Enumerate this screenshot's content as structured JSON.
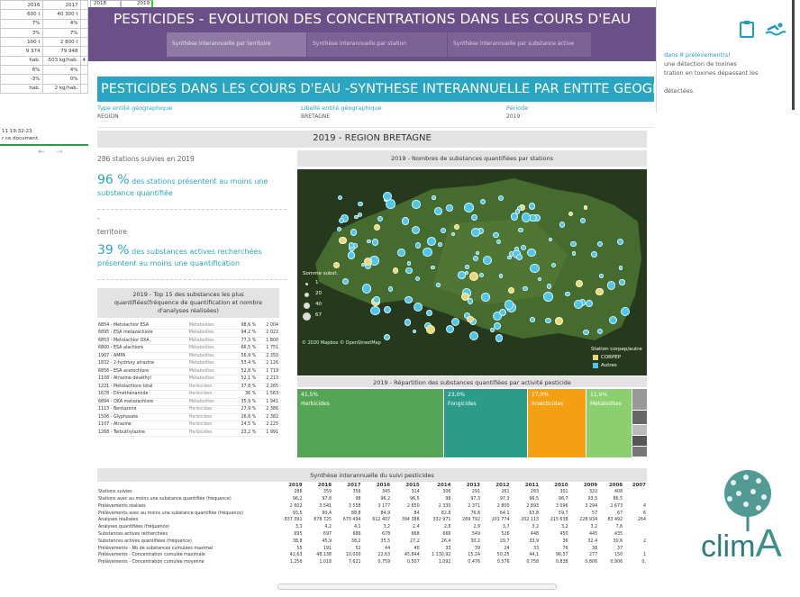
{
  "background_left": {
    "rows": [
      [
        "2016",
        "2017",
        ""
      ],
      [
        "600 t",
        "40 300 t",
        ""
      ],
      [
        "7%",
        "4%",
        ""
      ],
      [
        "3%",
        "7%",
        ""
      ],
      [
        "100 t",
        "2 800 t",
        ""
      ],
      [
        "9 374",
        "79 948",
        ""
      ],
      [
        "hab.",
        "503 kg/hab.",
        "4"
      ],
      [
        "6%",
        "4%",
        ""
      ],
      [
        "-3%",
        "0%",
        ""
      ],
      [
        "hab.",
        "2 kg/hab.",
        ""
      ]
    ],
    "top_cells": [
      "2018",
      "2019"
    ],
    "time": "11 19:32:23",
    "note": "r ce document.",
    "nav_back": "←",
    "nav_fwd": "→"
  },
  "background_right": {
    "lines": [
      "dans 8 prélèvement(s)",
      "une détection de toxines",
      "tration en toxines dépassant les",
      "",
      "détectées"
    ]
  },
  "app": {
    "title": "PESTICIDES - EVOLUTION DES CONCENTRATIONS DANS LES COURS D'EAU",
    "tabs": [
      "Synthèse interannuelle par territoire",
      "Synthèse interannuelle par station",
      "Synthèse interannuelle par substance active"
    ]
  },
  "banner": "PESTICIDES DANS LES COURS D'EAU -SYNTHESE INTERANNUELLE PAR ENTITE GEOGRAPHIQUE",
  "filters": [
    {
      "label": "Type entité géographique",
      "value": "REGION"
    },
    {
      "label": "Libellé entité géographique",
      "value": "BRETAGNE"
    },
    {
      "label": "Période",
      "value": "2019"
    }
  ],
  "year_region": "2019 - REGION BRETAGNE",
  "stations_text": "286 stations suivies en 2019",
  "stat1": {
    "pct": "96 %",
    "text": " des stations présentent au moins une substance quantifiée"
  },
  "dash": "-",
  "territoire": "territoire",
  "stat2": {
    "pct": "39 %",
    "text": " des substances actives recherchées présentent au moins une quantification"
  },
  "top15_title": "2019 - Top 15 des substances les plus quantifiées(fréquence de quantification et nombre d'analyses réalisées)",
  "top15": [
    [
      "6854 - Metolachlor ESA",
      "Métabolites",
      "98,6 %",
      "2 004"
    ],
    [
      "6895 - ESA metazachlore",
      "Métabolites",
      "94,2 %",
      "2 022"
    ],
    [
      "6853 - Metolachlor OXA",
      "Métabolites",
      "77,3 %",
      "1 800"
    ],
    [
      "6800 - ESA alachlore",
      "Métabolites",
      "66,5 %",
      "1 751"
    ],
    [
      "1907 - AMPA",
      "Métabolites",
      "56,9 %",
      "2 350"
    ],
    [
      "1832 - 2-hydroxy atrazine",
      "Métabolites",
      "53,4 %",
      "2 126"
    ],
    [
      "6856 - ESA acetochlore",
      "Métabolites",
      "52,8 %",
      "1 719"
    ],
    [
      "1108 - Atrazine déséthyl",
      "Métabolites",
      "52,1 %",
      "2 213"
    ],
    [
      "1221 - Métolachlore total",
      "Herbicides",
      "37,8 %",
      "2 265"
    ],
    [
      "1678 - Diméthénamide",
      "Herbicides",
      "36 %",
      "1 563"
    ],
    [
      "6894 - OXA metazachlore",
      "Métabolites",
      "35,9 %",
      "1 941"
    ],
    [
      "1113 - Bentazone",
      "Herbicides",
      "27,9 %",
      "2 386"
    ],
    [
      "1506 - Glyphosate",
      "Herbicides",
      "26,6 %",
      "2 382"
    ],
    [
      "1107 - Atrazine",
      "Herbicides",
      "24,5 %",
      "2 225"
    ],
    [
      "1268 - Terbuthylazine",
      "Herbicides",
      "23,2 %",
      "1 991"
    ]
  ],
  "map": {
    "title": "2019 - Nombres de substances quantifiées par stations",
    "legend_title": "Somme subst.",
    "legend_values": [
      "1",
      "20",
      "40",
      "67"
    ],
    "attribution": "© 2020 Mapbox © OpenStreetMap",
    "type_title": "Station corpep/autre",
    "type_items": [
      "CORPEP",
      "Autres"
    ],
    "colors": {
      "corpep": "#e9d77a",
      "autres": "#4bc6ec"
    }
  },
  "treemap": {
    "title": "2019 - Répartition des substances quantifiées par activité pesticide",
    "items": [
      {
        "pct": "41,5%",
        "label": "Herbicides",
        "color": "#54a656"
      },
      {
        "pct": "23,0%",
        "label": "Fongicides",
        "color": "#2b9b8a"
      },
      {
        "pct": "17,0%",
        "label": "Insecticides",
        "color": "#f5a012"
      },
      {
        "pct": "11,9%",
        "label": "Métabolites",
        "color": "#8ccf6f"
      }
    ]
  },
  "synthese": {
    "title": "Synthèse interannuelle du suivi pesticides",
    "years": [
      "2019",
      "2018",
      "2017",
      "2016",
      "2015",
      "2014",
      "2013",
      "2012",
      "2011",
      "2010",
      "2009",
      "2008",
      "2007"
    ],
    "rows": [
      [
        "Stations suivies",
        "286",
        "359",
        "356",
        "345",
        "314",
        "306",
        "291",
        "261",
        "283",
        "301",
        "322",
        "408",
        ""
      ],
      [
        "Stations avec au moins une substance quantifiée (fréquence)",
        "96,2",
        "97,8",
        "98",
        "96,2",
        "96,5",
        "98",
        "97,3",
        "97,3",
        "96,5",
        "96,7",
        "93,5",
        "86,5",
        ""
      ],
      [
        "Prélèvements réalisés",
        "2 602",
        "3 541",
        "3 558",
        "3 177",
        "2 650",
        "2 330",
        "2 371",
        "2 800",
        "2 893",
        "3 096",
        "3 294",
        "2 673",
        "4"
      ],
      [
        "Prélèvements avec au moins une substance quantifiée (fréquence)",
        "93,5",
        "90,4",
        "88,8",
        "84,9",
        "84",
        "82,8",
        "76,8",
        "64,1",
        "63,8",
        "59,7",
        "57",
        "67",
        "6"
      ],
      [
        "Analyses réalisées",
        "837 091",
        "878 725",
        "670 494",
        "612 407",
        "394 388",
        "332 971",
        "269 792",
        "201 774",
        "202 113",
        "215 638",
        "228 934",
        "83 492",
        "264"
      ],
      [
        "Analyses quantifiées (fréquence)",
        "3,1",
        "4,2",
        "4,1",
        "3,2",
        "2,4",
        "2,8",
        "2,9",
        "3,7",
        "3,2",
        "3,2",
        "3,2",
        "7,6",
        ""
      ],
      [
        "Substances actives recherchées",
        "695",
        "697",
        "686",
        "678",
        "668",
        "666",
        "549",
        "526",
        "448",
        "450",
        "445",
        "435",
        ""
      ],
      [
        "Substances actives quantifiées (fréquence)",
        "38,8",
        "45,9",
        "38,2",
        "35,5",
        "27,2",
        "26,4",
        "30,2",
        "29,7",
        "33,9",
        "36",
        "32,4",
        "30,6",
        "2"
      ],
      [
        "Prélèvements - Nb de substances cumulées maximal",
        "55",
        "191",
        "52",
        "44",
        "40",
        "33",
        "39",
        "24",
        "33",
        "76",
        "38",
        "37",
        ""
      ],
      [
        "Prélèvements - Concentration cumulée maximale",
        "42,63",
        "48,138",
        "10,000",
        "22,63",
        "45,844",
        "1 130,92",
        "15,24",
        "50,25",
        "44,1",
        "96,37",
        "277",
        "150",
        "1"
      ],
      [
        "Prélèvements - Concentration cumulée moyenne",
        "1,256",
        "1,018",
        "7,621",
        "0,759",
        "0,507",
        "1,092",
        "0,476",
        "0,576",
        "0,758",
        "0,838",
        "0,806",
        "0,906",
        "0,"
      ]
    ]
  },
  "logo": {
    "text": "clim",
    "accent": "A"
  }
}
